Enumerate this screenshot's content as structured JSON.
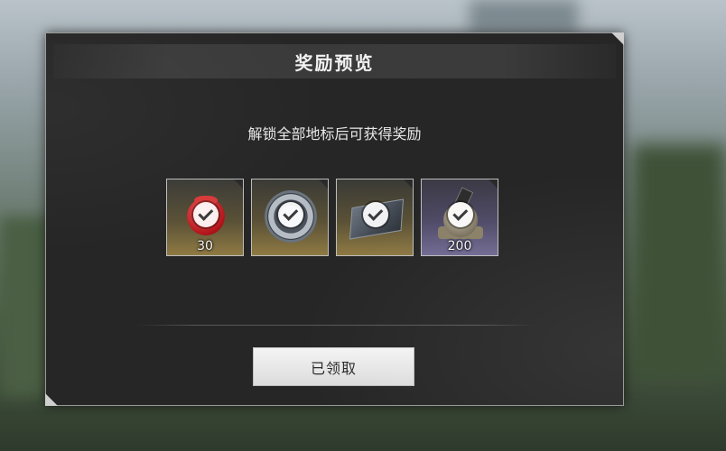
{
  "dialog": {
    "title": "奖励预览",
    "subtitle": "解锁全部地标后可获得奖励",
    "rewards": [
      {
        "icon": "red-token-icon",
        "quantity": "30",
        "rarity_color": "#8f7a43",
        "claimed": true
      },
      {
        "icon": "gear-disc-icon",
        "quantity": "",
        "rarity_color": "#8f7a43",
        "claimed": true
      },
      {
        "icon": "ticket-card-icon",
        "quantity": "",
        "rarity_color": "#8f7a43",
        "claimed": true
      },
      {
        "icon": "medal-icon",
        "quantity": "200",
        "rarity_color": "#716a93",
        "claimed": true
      }
    ],
    "button_label": "已领取"
  },
  "colors": {
    "panel_bg": "#262626",
    "gold_tier": "#8f7a43",
    "purple_tier": "#716a93",
    "button_bg": "#e8e8e8"
  }
}
